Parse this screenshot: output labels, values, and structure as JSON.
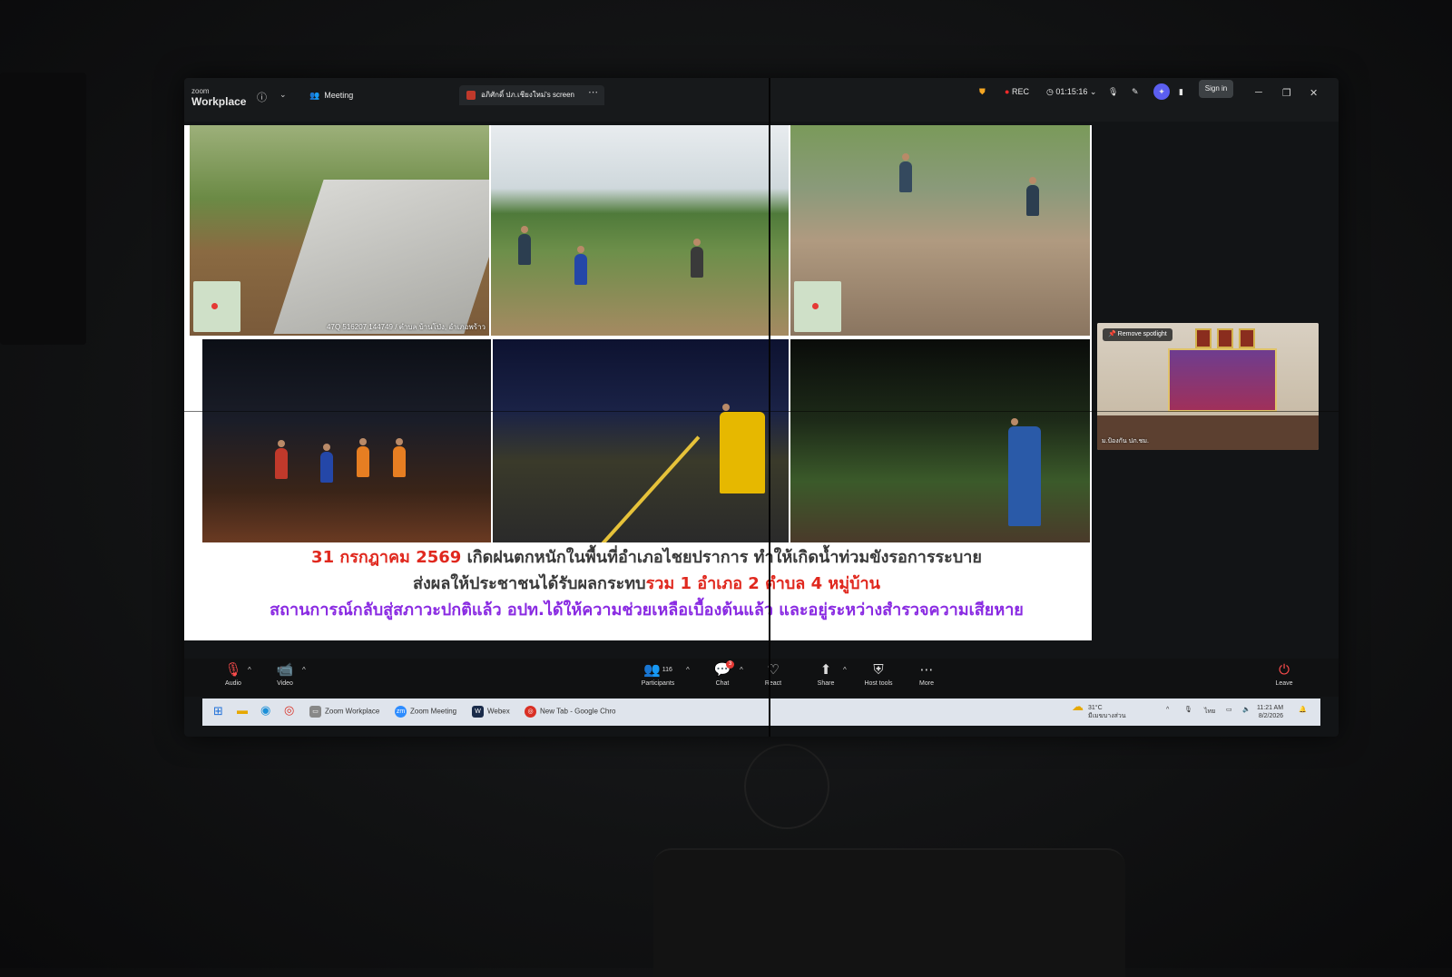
{
  "titlebar": {
    "brand_top": "zoom",
    "brand_name": "Workplace",
    "meeting_label": "Meeting",
    "screen_tab": "อภิศักดิ์ ปภ.เชียงใหม่'s screen",
    "rec_label": "REC",
    "timer": "01:15:16",
    "sign_in": "Sign in"
  },
  "slide": {
    "photo_captions": [
      "47Q 516207 144749 / ตำบล บ้านโป่ง, อำเภอพร้าว"
    ],
    "line1_date": "31 กรกฎาคม 2569",
    "line1_rest": " เกิดฝนตกหนักในพื้นที่อำเภอไชยปราการ ทำให้เกิดน้ำท่วมขังรอการระบาย",
    "line2_a": "ส่งผลให้ประชาชนได้รับผลกระทบ",
    "line2_b": "รวม 1 อำเภอ 2 ตำบล 4 หมู่บ้าน",
    "line3": "สถานการณ์กลับสู่สภาวะปกติแล้ว อปท.ได้ให้ความช่วยเหลือเบื้องต้นแล้ว และอยู่ระหว่างสำรวจความเสียหาย"
  },
  "spotlight": {
    "button": "Remove spotlight",
    "participant_name": "ม.ป้องกัน ปภ.ชม."
  },
  "toolbar": {
    "audio": "Audio",
    "video": "Video",
    "participants": "Participants",
    "participants_count": "116",
    "chat": "Chat",
    "chat_badge": "3",
    "react": "React",
    "share": "Share",
    "host_tools": "Host tools",
    "more": "More",
    "leave": "Leave"
  },
  "taskbar": {
    "apps": [
      "Zoom Workplace",
      "Zoom Meeting",
      "Webex",
      "New Tab - Google Chro"
    ],
    "weather_temp": "31°C",
    "weather_desc": "มีเมฆบางส่วน",
    "lang": "ไทย",
    "time": "11:21 AM",
    "date": "8/2/2026"
  },
  "colors": {
    "accent_red": "#e0281e",
    "accent_purple": "#8a2be2",
    "rec": "#ff2a2a",
    "zoom_bg": "#121416"
  }
}
